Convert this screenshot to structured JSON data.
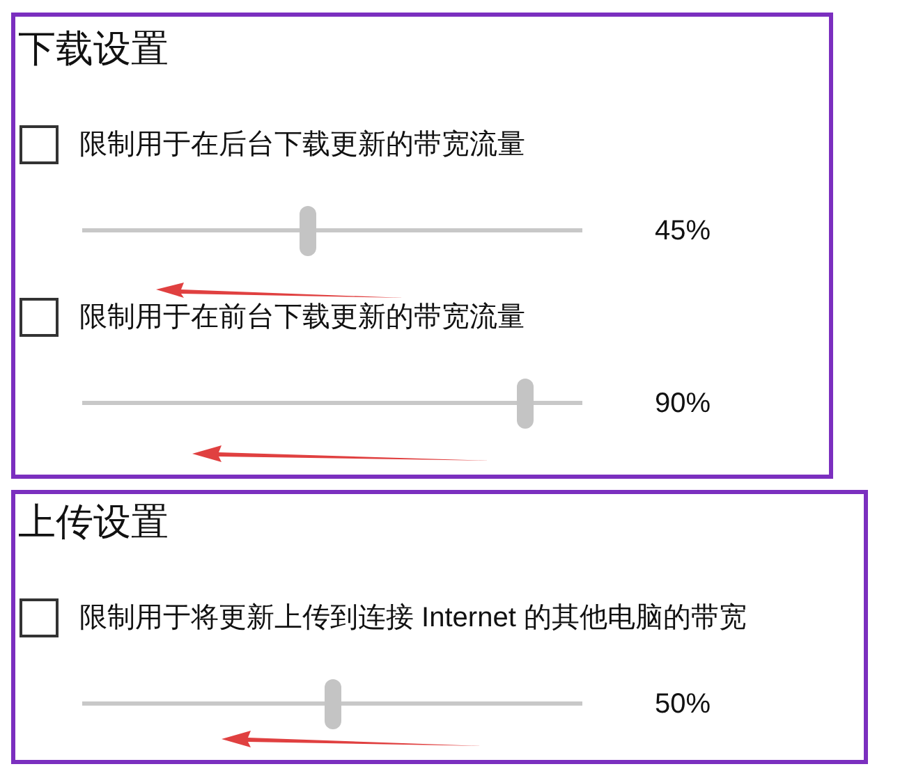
{
  "sections": [
    {
      "title": "下载设置",
      "options": [
        {
          "label": "限制用于在后台下载更新的带宽流量",
          "checked": false,
          "level": 0.45,
          "reading": "45%"
        },
        {
          "label": "限制用于在前台下载更新的带宽流量",
          "checked": false,
          "level": 0.9,
          "reading": "90%"
        }
      ]
    },
    {
      "title": "上传设置",
      "options": [
        {
          "label": "限制用于将更新上传到连接 Internet 的其他电脑的带宽",
          "checked": false,
          "level": 0.5,
          "reading": "50%"
        }
      ]
    }
  ]
}
